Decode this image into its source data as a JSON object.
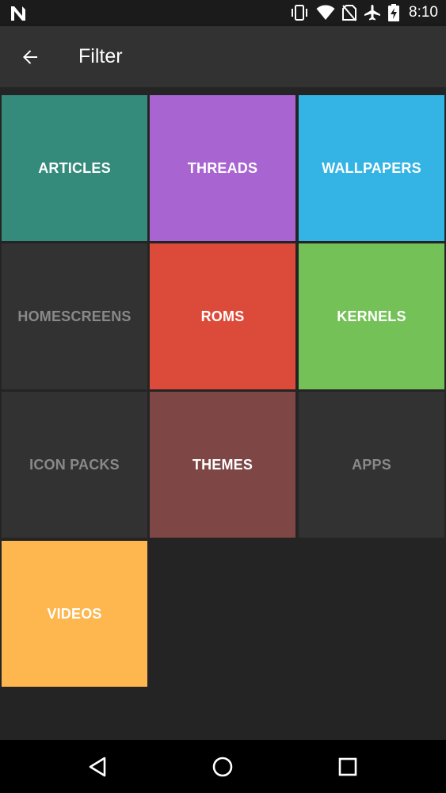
{
  "status_bar": {
    "time": "8:10",
    "icons": [
      "n-logo-icon",
      "vibrate-icon",
      "wifi-icon",
      "no-sim-icon",
      "airplane-icon",
      "battery-charging-icon"
    ]
  },
  "app_bar": {
    "title": "Filter",
    "back_icon": "arrow-back-icon"
  },
  "tiles": [
    {
      "label": "ARTICLES",
      "bg": "#348a7b",
      "fg": "#ffffff",
      "enabled": true
    },
    {
      "label": "THREADS",
      "bg": "#a864d0",
      "fg": "#ffffff",
      "enabled": true
    },
    {
      "label": "WALLPAPERS",
      "bg": "#34b4e4",
      "fg": "#ffffff",
      "enabled": true
    },
    {
      "label": "HOMESCREENS",
      "bg": "#333233",
      "fg": "#8a898a",
      "enabled": false
    },
    {
      "label": "ROMS",
      "bg": "#dc4a3a",
      "fg": "#ffffff",
      "enabled": true
    },
    {
      "label": "KERNELS",
      "bg": "#74c158",
      "fg": "#ffffff",
      "enabled": true
    },
    {
      "label": "ICON PACKS",
      "bg": "#333233",
      "fg": "#8a898a",
      "enabled": false
    },
    {
      "label": "THEMES",
      "bg": "#7e4644",
      "fg": "#ffffff",
      "enabled": true
    },
    {
      "label": "APPS",
      "bg": "#333233",
      "fg": "#8a898a",
      "enabled": false
    },
    {
      "label": "VIDEOS",
      "bg": "#feb64e",
      "fg": "#ffffff",
      "enabled": true
    }
  ],
  "nav_bar": {
    "icons": [
      "back-triangle-icon",
      "home-circle-icon",
      "recents-square-icon"
    ]
  }
}
